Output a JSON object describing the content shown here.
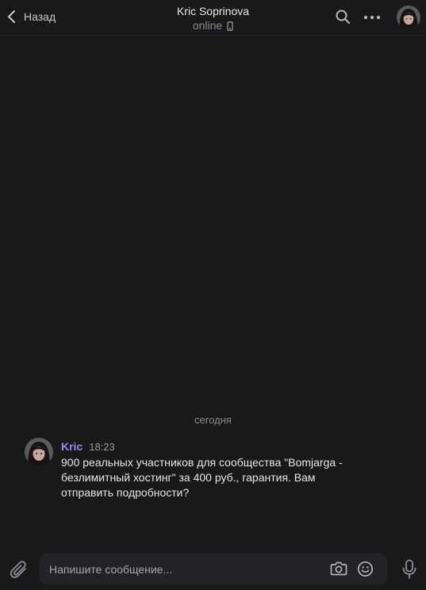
{
  "header": {
    "back_label": "Назад",
    "title": "Kric Soprinova",
    "status": "online",
    "icons": [
      "chevron-left-icon",
      "mobile-phone-icon",
      "search-icon",
      "more-dots-icon"
    ]
  },
  "messages": {
    "date_separator": "сегодня",
    "items": [
      {
        "author": "Kric",
        "time": "18:23",
        "text": "900 реальных участников для сообщества \"Bomjarga -\nбезлимитный хостинг\" за 400 руб., гарантия. Вам\nотправить подробности?"
      }
    ]
  },
  "composer": {
    "placeholder": "Напишите сообщение...",
    "icons": [
      "paperclip-icon",
      "camera-icon",
      "emoji-icon",
      "microphone-icon"
    ]
  },
  "colors": {
    "background": "#19191a",
    "accent_author": "#9a86ff",
    "input_bg": "#232326"
  }
}
